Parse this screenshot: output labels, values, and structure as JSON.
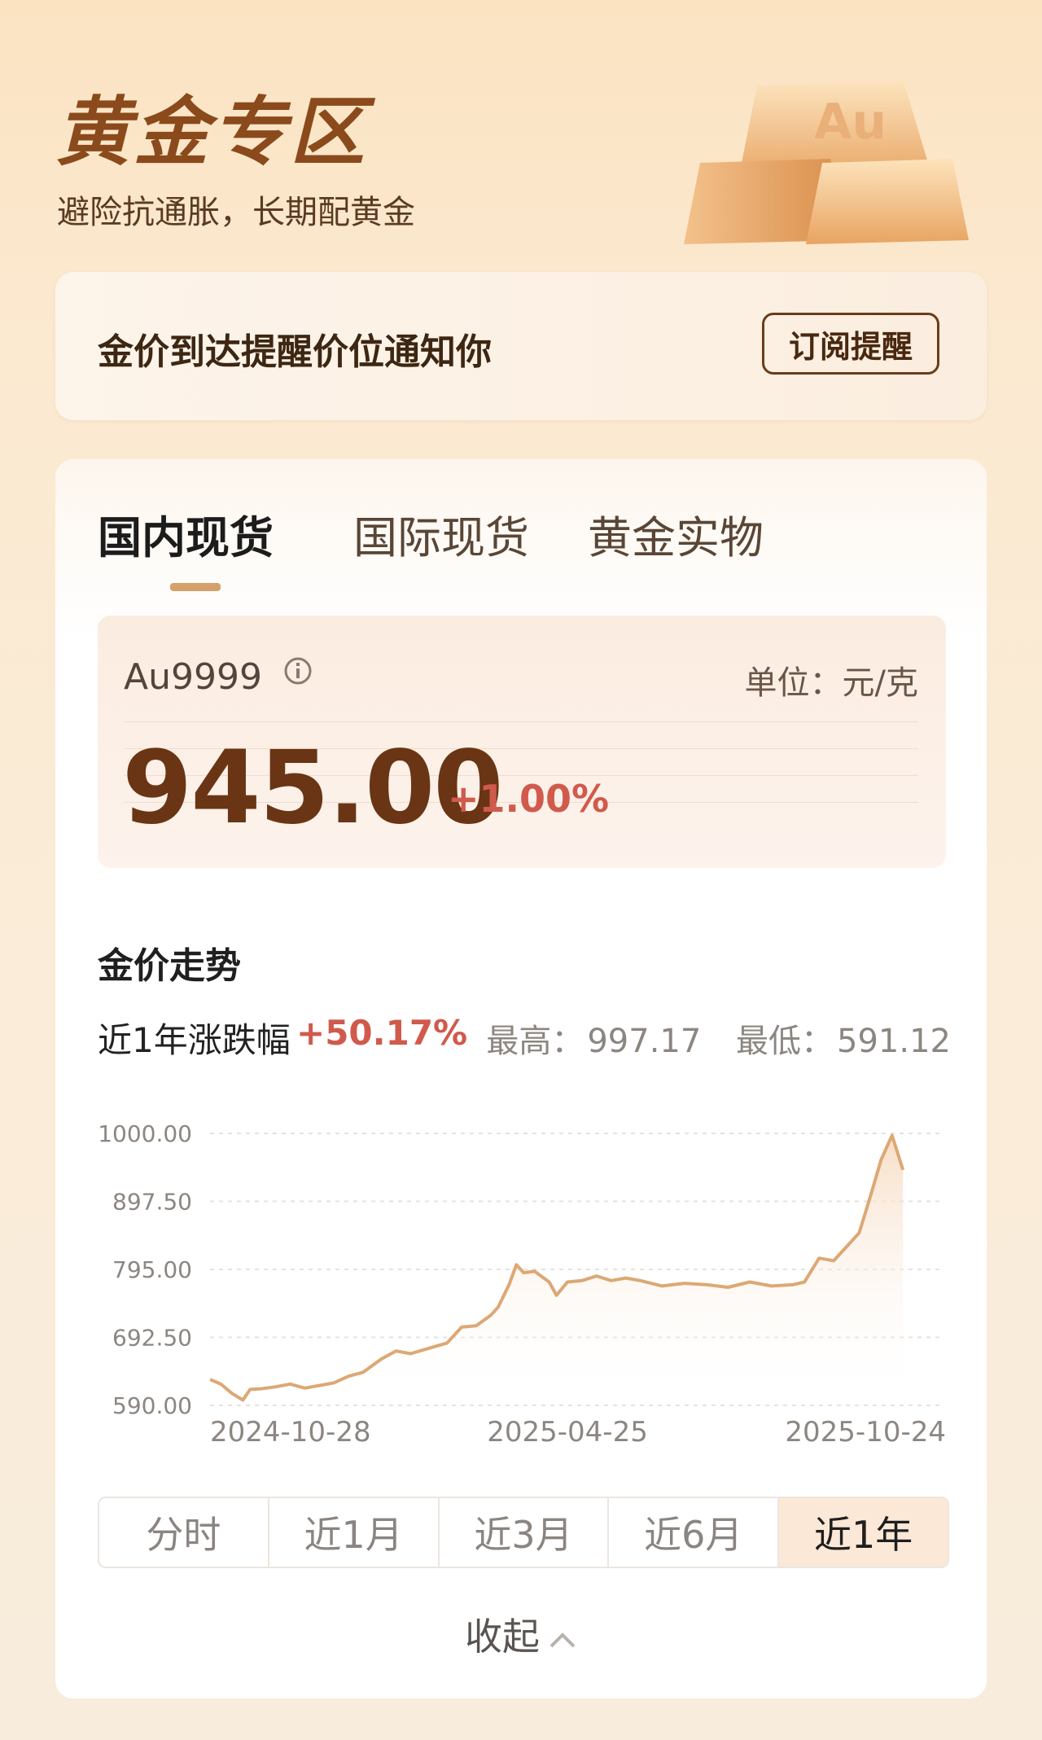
{
  "header": {
    "title": "黄金专区",
    "subtitle": "避险抗通胀，长期配黄金",
    "art_label": "Au"
  },
  "alert": {
    "text": "金价到达提醒价位通知你",
    "button_label": "订阅提醒"
  },
  "tabs": [
    {
      "label": "国内现货",
      "active": true
    },
    {
      "label": "国际现货",
      "active": false
    },
    {
      "label": "黄金实物",
      "active": false
    }
  ],
  "quote": {
    "code": "Au9999",
    "unit": "单位：元/克",
    "price": "945.00",
    "change": "+1.00%"
  },
  "trend": {
    "title": "金价走势",
    "range_label": "近1年涨跌幅",
    "range_value": "+50.17%",
    "high_label": "最高：",
    "high_value": "997.17",
    "low_label": "最低：",
    "low_value": "591.12"
  },
  "periods": [
    {
      "label": "分时",
      "active": false
    },
    {
      "label": "近1月",
      "active": false
    },
    {
      "label": "近3月",
      "active": false
    },
    {
      "label": "近6月",
      "active": false
    },
    {
      "label": "近1年",
      "active": true
    }
  ],
  "collapse_label": "收起",
  "colors": {
    "accent_gold": "#d4a06c",
    "price_brown": "#6a3514",
    "up_red": "#d05a4c",
    "line": "#dca874"
  },
  "chart_data": {
    "type": "area",
    "y_ticks": [
      "1000.00",
      "897.50",
      "795.00",
      "692.50",
      "590.00"
    ],
    "ylim": [
      590,
      1000
    ],
    "x_tick_labels": [
      "2024-10-28",
      "2025-04-25",
      "2025-10-24"
    ],
    "x_tick_positions": [
      0.145,
      0.49,
      0.835
    ],
    "grid": true,
    "series": [
      {
        "values": [
          [
            0.0,
            629
          ],
          [
            0.015,
            622
          ],
          [
            0.03,
            608
          ],
          [
            0.045,
            598
          ],
          [
            0.055,
            614
          ],
          [
            0.07,
            615
          ],
          [
            0.09,
            618
          ],
          [
            0.11,
            622
          ],
          [
            0.13,
            616
          ],
          [
            0.15,
            620
          ],
          [
            0.17,
            624
          ],
          [
            0.19,
            634
          ],
          [
            0.21,
            640
          ],
          [
            0.235,
            660
          ],
          [
            0.255,
            672
          ],
          [
            0.275,
            668
          ],
          [
            0.3,
            676
          ],
          [
            0.325,
            684
          ],
          [
            0.345,
            708
          ],
          [
            0.365,
            710
          ],
          [
            0.385,
            726
          ],
          [
            0.395,
            738
          ],
          [
            0.41,
            772
          ],
          [
            0.42,
            802
          ],
          [
            0.43,
            790
          ],
          [
            0.445,
            792
          ],
          [
            0.465,
            776
          ],
          [
            0.475,
            756
          ],
          [
            0.49,
            776
          ],
          [
            0.51,
            778
          ],
          [
            0.53,
            785
          ],
          [
            0.55,
            778
          ],
          [
            0.57,
            782
          ],
          [
            0.59,
            778
          ],
          [
            0.62,
            770
          ],
          [
            0.65,
            774
          ],
          [
            0.68,
            772
          ],
          [
            0.71,
            768
          ],
          [
            0.74,
            776
          ],
          [
            0.77,
            770
          ],
          [
            0.8,
            772
          ],
          [
            0.815,
            776
          ],
          [
            0.835,
            812
          ],
          [
            0.855,
            808
          ],
          [
            0.875,
            832
          ],
          [
            0.89,
            850
          ],
          [
            0.905,
            904
          ],
          [
            0.92,
            960
          ],
          [
            0.935,
            997
          ],
          [
            0.95,
            945
          ]
        ]
      }
    ]
  }
}
